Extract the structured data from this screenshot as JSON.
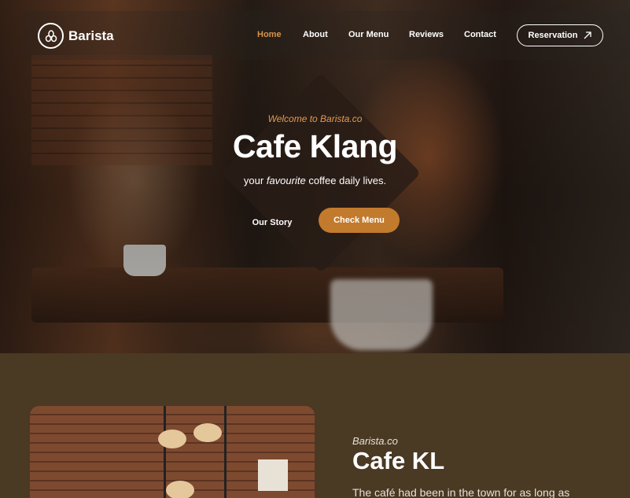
{
  "brand": {
    "name": "Barista"
  },
  "nav": {
    "items": [
      {
        "label": "Home",
        "active": true
      },
      {
        "label": "About"
      },
      {
        "label": "Our Menu"
      },
      {
        "label": "Reviews"
      },
      {
        "label": "Contact"
      }
    ],
    "reservation_label": "Reservation",
    "reservation_icon": "arrow-up-right-icon"
  },
  "hero": {
    "welcome": "Welcome to Barista.co",
    "title": "Cafe Klang",
    "subtitle_pre": "your ",
    "subtitle_em": "favourite",
    "subtitle_post": " coffee daily lives.",
    "story_button": "Our Story",
    "menu_button": "Check Menu"
  },
  "about": {
    "kicker": "Barista.co",
    "title": "Cafe KL",
    "body": "The café had been in the town for as long as"
  },
  "colors": {
    "accent": "#c27a2d",
    "background": "#4a3923",
    "active_nav": "#d9944a"
  }
}
